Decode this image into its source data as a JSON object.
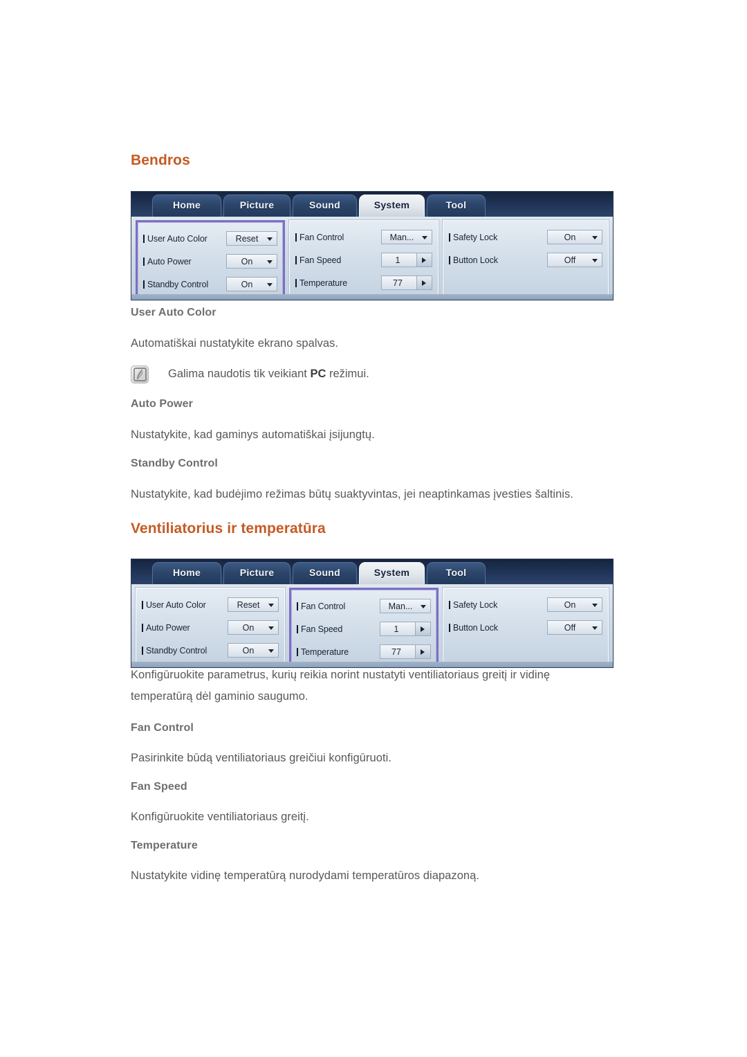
{
  "colors": {
    "heading": "#c55a23",
    "subheading": "#6e6e6e",
    "body": "#58585a",
    "osd_highlight_purple": "#7b6fc4",
    "osd_tab_bar": "#22375b",
    "osd_panel": "#cfdbe7"
  },
  "sections": [
    {
      "id": "bendros",
      "title": "Bendros",
      "osd": {
        "tabs": [
          {
            "label": "Home",
            "active": false
          },
          {
            "label": "Picture",
            "active": false
          },
          {
            "label": "Sound",
            "active": false
          },
          {
            "label": "System",
            "active": true
          },
          {
            "label": "Tool",
            "active": false
          }
        ],
        "columns": [
          {
            "highlighted": true,
            "rows": [
              {
                "label": "User Auto Color",
                "value": "Reset",
                "control": "select"
              },
              {
                "label": "Auto Power",
                "value": "On",
                "control": "select"
              },
              {
                "label": "Standby Control",
                "value": "On",
                "control": "select"
              }
            ]
          },
          {
            "highlighted": false,
            "rows": [
              {
                "label": "Fan Control",
                "value": "Man...",
                "control": "select"
              },
              {
                "label": "Fan Speed",
                "value": "1",
                "control": "stepper"
              },
              {
                "label": "Temperature",
                "value": "77",
                "control": "stepper"
              }
            ]
          },
          {
            "highlighted": false,
            "rows": [
              {
                "label": "Safety Lock",
                "value": "On",
                "control": "select"
              },
              {
                "label": "Button Lock",
                "value": "Off",
                "control": "select"
              }
            ]
          }
        ]
      },
      "items": [
        {
          "heading": "User Auto Color",
          "body": "Automatiškai nustatykite ekrano spalvas.",
          "note": {
            "icon": "note-pencil-icon",
            "before": "Galima naudotis tik veikiant ",
            "bold": "PC",
            "after": " režimui."
          }
        },
        {
          "heading": "Auto Power",
          "body": "Nustatykite, kad gaminys automatiškai įsijungtų."
        },
        {
          "heading": "Standby Control",
          "body": "Nustatykite, kad budėjimo režimas būtų suaktyvintas, jei neaptinkamas įvesties šaltinis."
        }
      ]
    },
    {
      "id": "ventiliatorius",
      "title": "Ventiliatorius ir temperatūra",
      "osd": {
        "tabs": [
          {
            "label": "Home",
            "active": false
          },
          {
            "label": "Picture",
            "active": false
          },
          {
            "label": "Sound",
            "active": false
          },
          {
            "label": "System",
            "active": true
          },
          {
            "label": "Tool",
            "active": false
          }
        ],
        "columns": [
          {
            "highlighted": false,
            "rows": [
              {
                "label": "User Auto Color",
                "value": "Reset",
                "control": "select"
              },
              {
                "label": "Auto Power",
                "value": "On",
                "control": "select"
              },
              {
                "label": "Standby Control",
                "value": "On",
                "control": "select"
              }
            ]
          },
          {
            "highlighted": true,
            "rows": [
              {
                "label": "Fan Control",
                "value": "Man...",
                "control": "select"
              },
              {
                "label": "Fan Speed",
                "value": "1",
                "control": "stepper"
              },
              {
                "label": "Temperature",
                "value": "77",
                "control": "stepper"
              }
            ]
          },
          {
            "highlighted": false,
            "rows": [
              {
                "label": "Safety Lock",
                "value": "On",
                "control": "select"
              },
              {
                "label": "Button Lock",
                "value": "Off",
                "control": "select"
              }
            ]
          }
        ]
      },
      "intro": "Konfigūruokite parametrus, kurių reikia norint nustatyti ventiliatoriaus greitį ir vidinę temperatūrą dėl gaminio saugumo.",
      "items": [
        {
          "heading": "Fan Control",
          "body": "Pasirinkite būdą ventiliatoriaus greičiui konfigūruoti."
        },
        {
          "heading": "Fan Speed",
          "body": "Konfigūruokite ventiliatoriaus greitį."
        },
        {
          "heading": "Temperature",
          "body": "Nustatykite vidinę temperatūrą nurodydami temperatūros diapazoną."
        }
      ]
    }
  ]
}
